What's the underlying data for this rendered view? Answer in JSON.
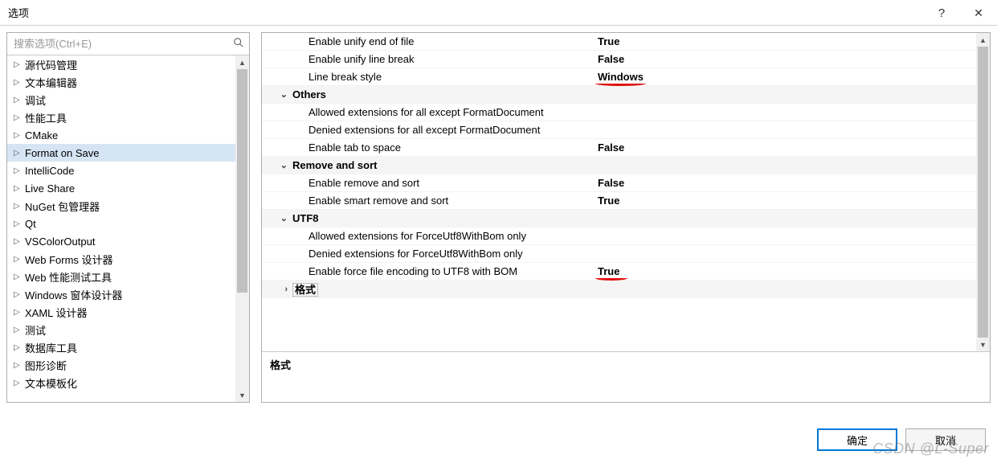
{
  "titlebar": {
    "title": "选项",
    "help": "?",
    "close": "✕"
  },
  "search": {
    "placeholder": "搜索选项(Ctrl+E)"
  },
  "tree": {
    "items": [
      {
        "label": "源代码管理",
        "selected": false
      },
      {
        "label": "文本编辑器",
        "selected": false
      },
      {
        "label": "调试",
        "selected": false
      },
      {
        "label": "性能工具",
        "selected": false
      },
      {
        "label": "CMake",
        "selected": false
      },
      {
        "label": "Format on Save",
        "selected": true
      },
      {
        "label": "IntelliCode",
        "selected": false
      },
      {
        "label": "Live Share",
        "selected": false
      },
      {
        "label": "NuGet 包管理器",
        "selected": false
      },
      {
        "label": "Qt",
        "selected": false
      },
      {
        "label": "VSColorOutput",
        "selected": false
      },
      {
        "label": "Web Forms 设计器",
        "selected": false
      },
      {
        "label": "Web 性能测试工具",
        "selected": false
      },
      {
        "label": "Windows 窗体设计器",
        "selected": false
      },
      {
        "label": "XAML 设计器",
        "selected": false
      },
      {
        "label": "测试",
        "selected": false
      },
      {
        "label": "数据库工具",
        "selected": false
      },
      {
        "label": "图形诊断",
        "selected": false
      },
      {
        "label": "文本模板化",
        "selected": false
      }
    ]
  },
  "grid": {
    "rows": [
      {
        "t": "prop",
        "label": "Enable unify end of file",
        "value": "True"
      },
      {
        "t": "prop",
        "label": "Enable unify line break",
        "value": "False"
      },
      {
        "t": "prop",
        "label": "Line break style",
        "value": "Windows",
        "mark": true
      },
      {
        "t": "cat",
        "label": "Others",
        "exp": "v"
      },
      {
        "t": "prop",
        "label": "Allowed extensions for all except FormatDocument",
        "value": ""
      },
      {
        "t": "prop",
        "label": "Denied extensions for all except FormatDocument",
        "value": ""
      },
      {
        "t": "prop",
        "label": "Enable tab to space",
        "value": "False"
      },
      {
        "t": "cat",
        "label": "Remove and sort",
        "exp": "v"
      },
      {
        "t": "prop",
        "label": "Enable remove and sort",
        "value": "False"
      },
      {
        "t": "prop",
        "label": "Enable smart remove and sort",
        "value": "True"
      },
      {
        "t": "cat",
        "label": "UTF8",
        "exp": "v"
      },
      {
        "t": "prop",
        "label": "Allowed extensions for ForceUtf8WithBom only",
        "value": ""
      },
      {
        "t": "prop",
        "label": "Denied extensions for ForceUtf8WithBom only",
        "value": ""
      },
      {
        "t": "prop",
        "label": "Enable force file encoding to UTF8 with BOM",
        "value": "True",
        "mark": true
      },
      {
        "t": "cat",
        "label": "格式",
        "exp": ">",
        "sel": true
      }
    ]
  },
  "desc": {
    "title": "格式"
  },
  "buttons": {
    "ok": "确定",
    "cancel": "取消"
  },
  "watermark": "CSDN @L-Super"
}
